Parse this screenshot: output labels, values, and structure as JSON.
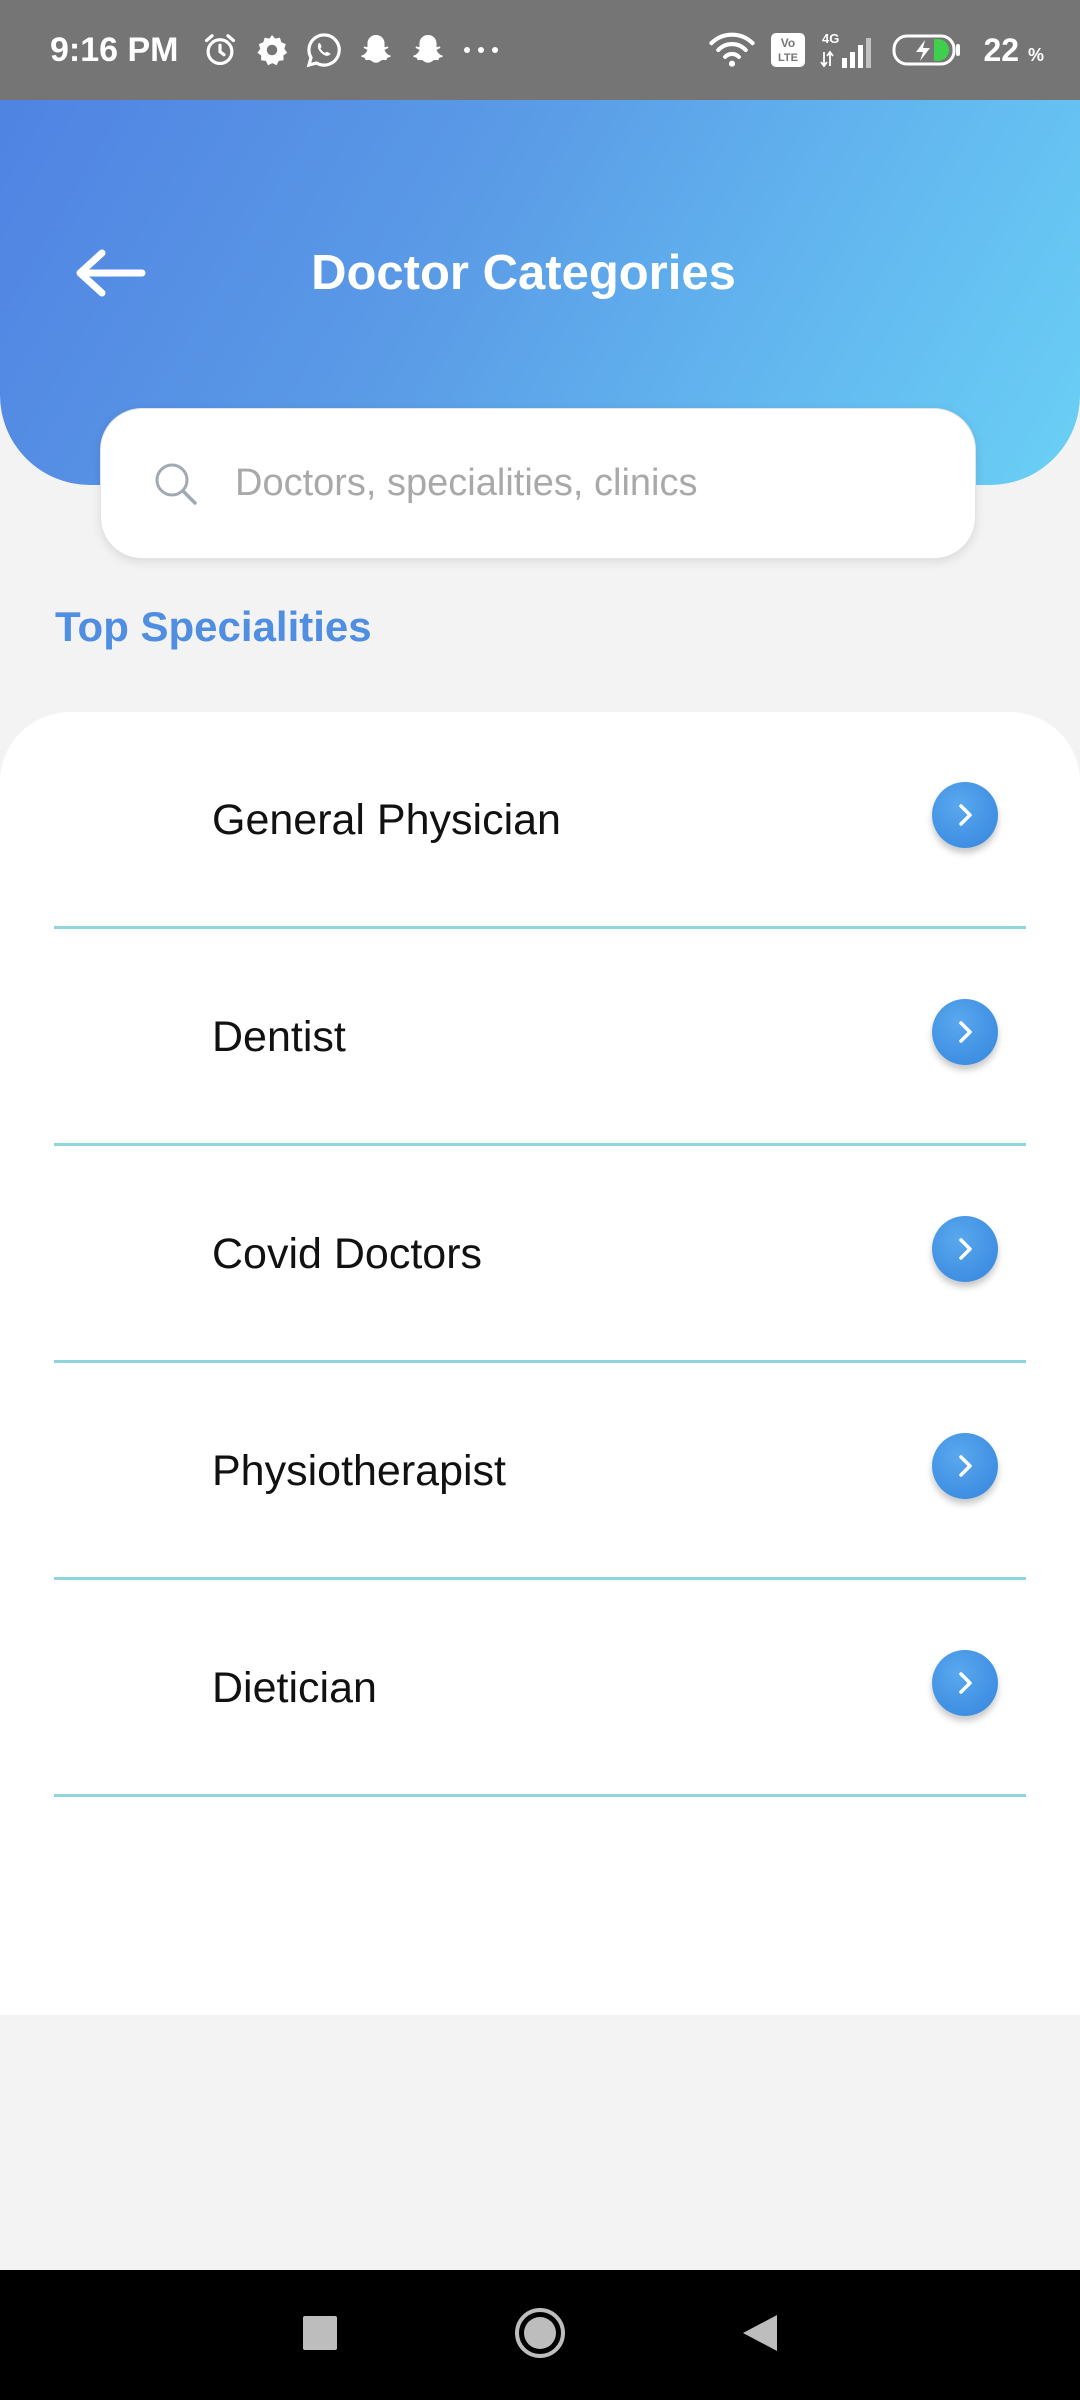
{
  "status_bar": {
    "time": "9:16 PM",
    "left_icons": [
      "alarm-icon",
      "settings-icon",
      "whatsapp-icon",
      "snapchat-icon",
      "snapchat-icon",
      "more-icon"
    ],
    "right_icons": [
      "wifi-icon",
      "volte-icon",
      "signal-icon",
      "battery-charging-icon"
    ],
    "volte_label": "Vo LTE",
    "network_label": "4G",
    "battery_level": "22",
    "battery_unit": "%"
  },
  "header": {
    "title": "Doctor Categories",
    "back_icon": "arrow-left-icon"
  },
  "search": {
    "placeholder": "Doctors, specialities, clinics",
    "value": ""
  },
  "section": {
    "title": "Top Specialities"
  },
  "specialities": [
    {
      "label": "General Physician"
    },
    {
      "label": "Dentist"
    },
    {
      "label": "Covid Doctors"
    },
    {
      "label": "Physiotherapist"
    },
    {
      "label": "Dietician"
    }
  ],
  "nav_bar": {
    "buttons": [
      "recents-icon",
      "home-icon",
      "back-icon"
    ]
  },
  "colors": {
    "status_bar": "#757575",
    "header_gradient_start": "#5083e3",
    "header_gradient_end": "#6ad0f5",
    "accent": "#4f8ee1",
    "divider": "#8fd6dc",
    "arrow_button": "#3f8fe3",
    "background": "#f3f3f3"
  }
}
